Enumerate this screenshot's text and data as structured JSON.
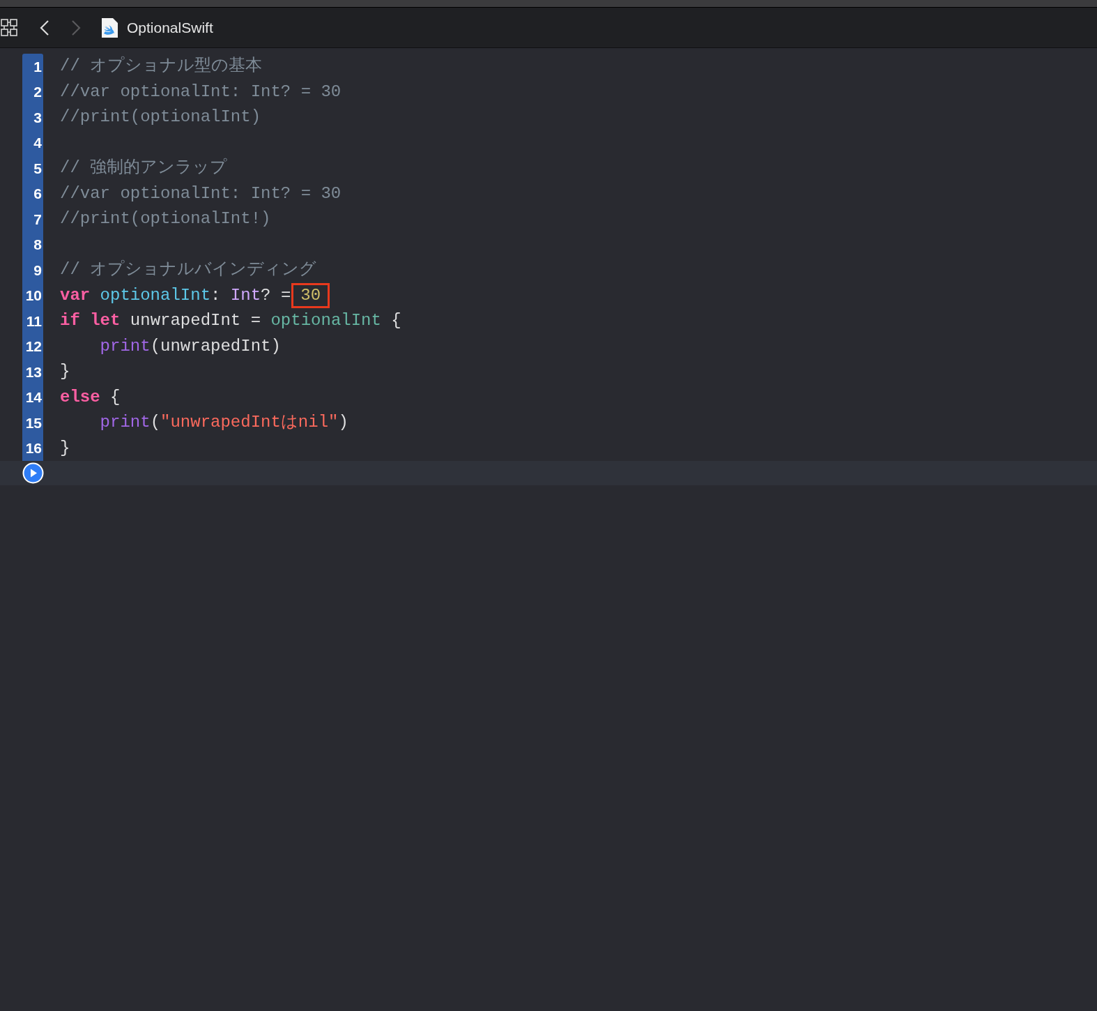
{
  "toolbar": {
    "file_name": "OptionalSwift"
  },
  "editor": {
    "lines": [
      {
        "number": "1",
        "tokens": [
          {
            "kind": "comment",
            "text": "// オプショナル型の基本",
            "boxed": false
          }
        ]
      },
      {
        "number": "2",
        "tokens": [
          {
            "kind": "comment",
            "text": "//var optionalInt: Int? = 30",
            "boxed": false
          }
        ]
      },
      {
        "number": "3",
        "tokens": [
          {
            "kind": "comment",
            "text": "//print(optionalInt)",
            "boxed": false
          }
        ]
      },
      {
        "number": "4"
      },
      {
        "number": "5",
        "tokens": [
          {
            "kind": "comment",
            "text": "// 強制的アンラップ",
            "boxed": false
          }
        ]
      },
      {
        "number": "6",
        "tokens": [
          {
            "kind": "comment",
            "text": "//var optionalInt: Int? = 30",
            "boxed": false
          }
        ]
      },
      {
        "number": "7",
        "tokens": [
          {
            "kind": "comment",
            "text": "//print(optionalInt!)",
            "boxed": false
          }
        ]
      },
      {
        "number": "8"
      },
      {
        "number": "9",
        "tokens": [
          {
            "kind": "comment",
            "text": "// オプショナルバインディング",
            "boxed": false
          }
        ]
      },
      {
        "number": "10",
        "tokens": [
          {
            "kind": "keyword",
            "text": "var ",
            "boxed": false
          },
          {
            "kind": "declaration",
            "text": "optionalInt",
            "boxed": false
          },
          {
            "kind": "plain",
            "text": ": ",
            "boxed": false
          },
          {
            "kind": "type",
            "text": "Int",
            "boxed": false
          },
          {
            "kind": "plain",
            "text": "? =",
            "boxed": false
          },
          {
            "kind": "number",
            "text": "30",
            "boxed": true
          }
        ]
      },
      {
        "number": "11",
        "tokens": [
          {
            "kind": "keyword",
            "text": "if let ",
            "boxed": false
          },
          {
            "kind": "plain",
            "text": "unwrapedInt = ",
            "boxed": false
          },
          {
            "kind": "reference",
            "text": "optionalInt",
            "boxed": false
          },
          {
            "kind": "plain",
            "text": " {",
            "boxed": false
          }
        ]
      },
      {
        "number": "12",
        "tokens": [
          {
            "kind": "function",
            "text": "    print",
            "boxed": false
          },
          {
            "kind": "plain",
            "text": "(unwrapedInt)",
            "boxed": false
          }
        ]
      },
      {
        "number": "13",
        "tokens": [
          {
            "kind": "plain",
            "text": "}",
            "boxed": false
          }
        ]
      },
      {
        "number": "14",
        "tokens": [
          {
            "kind": "keyword",
            "text": "else",
            "boxed": false
          },
          {
            "kind": "plain",
            "text": " {",
            "boxed": false
          }
        ]
      },
      {
        "number": "15",
        "tokens": [
          {
            "kind": "function",
            "text": "    print",
            "boxed": false
          },
          {
            "kind": "plain",
            "text": "(",
            "boxed": false
          },
          {
            "kind": "string",
            "text": "\"unwrapedIntはnil\"",
            "boxed": false
          },
          {
            "kind": "plain",
            "text": ")",
            "boxed": false
          }
        ]
      },
      {
        "number": "16",
        "tokens": [
          {
            "kind": "plain",
            "text": "}",
            "boxed": false
          }
        ]
      }
    ]
  }
}
